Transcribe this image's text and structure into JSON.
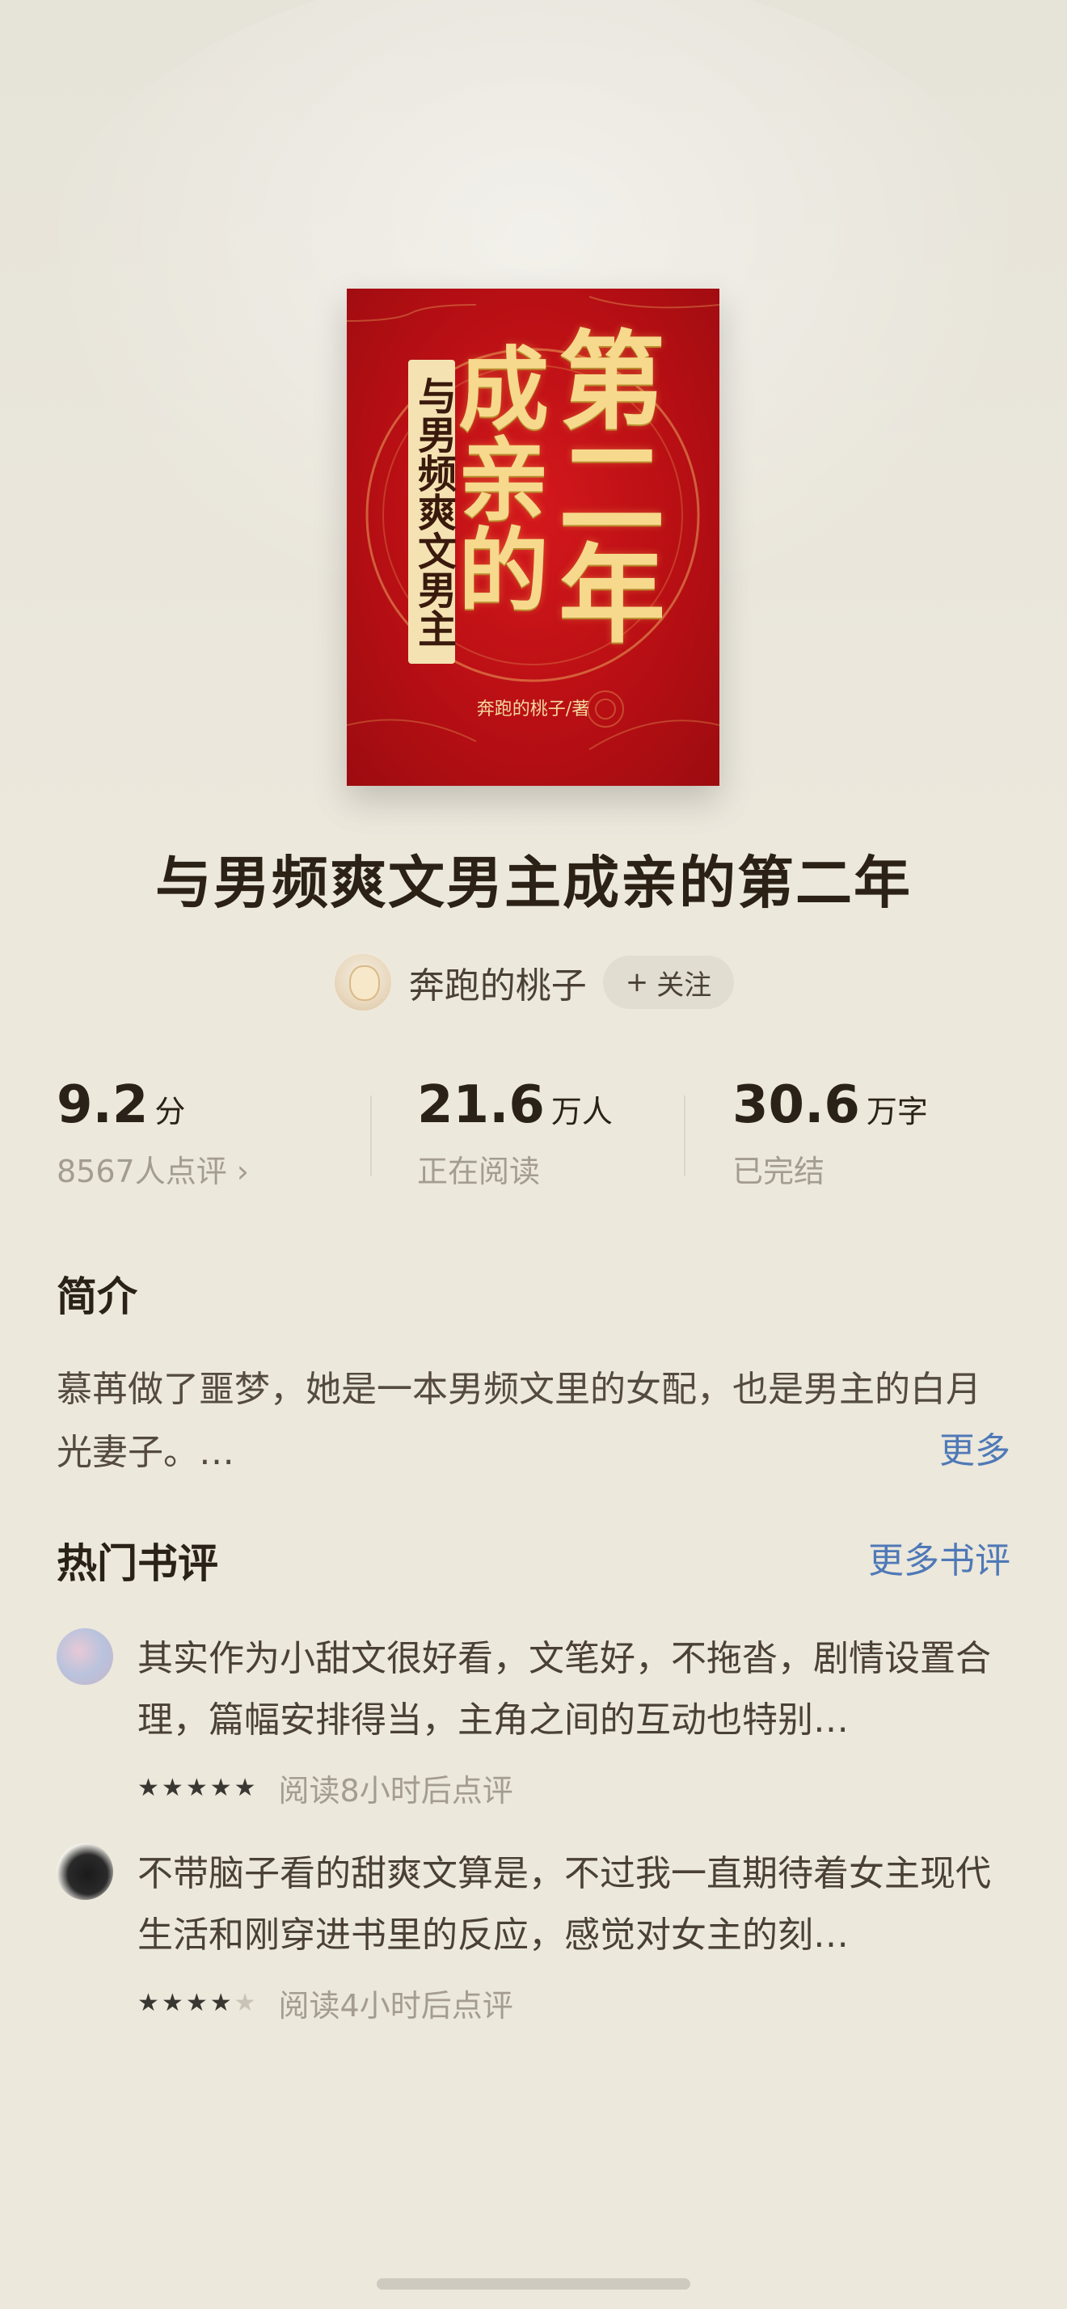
{
  "book": {
    "title": "与男频爽文男主成亲的第二年",
    "cover": {
      "vertical_subtitle": "与男频爽文男主",
      "title_col1": [
        "成",
        "亲",
        "的"
      ],
      "title_col2": [
        "第",
        "二",
        "年"
      ],
      "author_line": "奔跑的桃子/著",
      "colors": {
        "background": "#c8141a",
        "gold": "#f6d98c"
      }
    }
  },
  "author": {
    "name": "奔跑的桃子",
    "follow_label": "关注",
    "follow_icon": "plus-icon"
  },
  "stats": [
    {
      "value": "9.2",
      "unit": "分",
      "sub": "8567人点评 ›"
    },
    {
      "value": "21.6",
      "unit": "万人",
      "sub": "正在阅读"
    },
    {
      "value": "30.6",
      "unit": "万字",
      "sub": "已完结"
    }
  ],
  "intro": {
    "heading": "简介",
    "text": "慕苒做了噩梦，她是一本男频文里的女配，也是男主的白月光妻子。…",
    "more_label": "更多"
  },
  "reviews": {
    "heading": "热门书评",
    "more_label": "更多书评",
    "items": [
      {
        "text": "其实作为小甜文很好看，文笔好，不拖沓，剧情设置合理，篇幅安排得当，主角之间的互动也特别…",
        "stars": 5,
        "time": "阅读8小时后点评"
      },
      {
        "text": "不带脑子看的甜爽文算是，不过我一直期待着女主现代生活和刚穿进书里的反应，感觉对女主的刻…",
        "stars": 4,
        "time": "阅读4小时后点评"
      }
    ]
  },
  "colors": {
    "background": "#ece8dc",
    "link": "#4f79b7",
    "muted": "#a49c90"
  }
}
